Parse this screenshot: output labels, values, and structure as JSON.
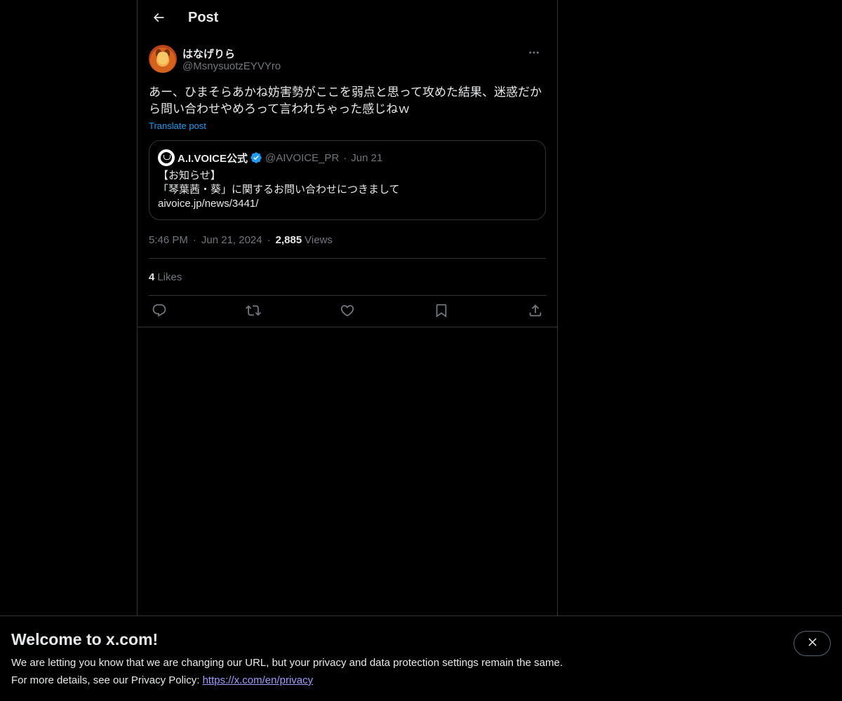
{
  "header": {
    "title": "Post"
  },
  "post": {
    "author": {
      "display_name": "はなげりら",
      "handle": "@MsnysuotzEYVYro"
    },
    "text": "あー、ひまそらあかね妨害勢がここを弱点と思って攻めた結果、迷惑だから問い合わせやめろって言われちゃった感じねｗ",
    "translate_label": "Translate post",
    "quote": {
      "name": "A.I.VOICE公式",
      "handle": "@AIVOICE_PR",
      "date": "Jun 21",
      "lines": [
        "【お知らせ】",
        "「琴葉茜・葵」に関するお問い合わせにつきまして",
        "aivoice.jp/news/3441/"
      ]
    },
    "time": "5:46 PM",
    "date": "Jun 21, 2024",
    "views_count": "2,885",
    "views_label": "Views",
    "likes_count": "4",
    "likes_label": "Likes"
  },
  "icons": [
    "back-arrow-icon",
    "more-icon",
    "verified-icon",
    "reply-icon",
    "repost-icon",
    "like-icon",
    "bookmark-icon",
    "share-icon",
    "close-icon"
  ],
  "colors": {
    "accent": "#1d9bf0",
    "muted": "#71767b",
    "border": "#2f3336",
    "link": "#9d9dff"
  },
  "banner": {
    "title": "Welcome to x.com!",
    "line1": "We are letting you know that we are changing our URL, but your privacy and data protection settings remain the same.",
    "line2_prefix": "For more details, see our Privacy Policy: ",
    "link": "https://x.com/en/privacy"
  }
}
